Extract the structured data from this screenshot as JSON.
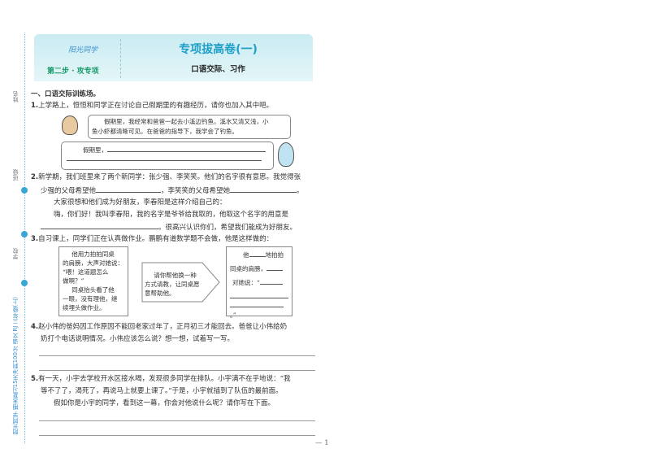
{
  "sidebar": {
    "name_label": "姓名",
    "class_label": "班级",
    "school_label": "学校",
    "series": "阳光同学 期末复习15天冲刺100分 语文 RJ 三年级(上)"
  },
  "header": {
    "logo": "阳光同学",
    "step": "第二步 · 攻专项",
    "title": "专项拔高卷(一)",
    "subtitle": "口语交际、习作"
  },
  "section1": "一、口语交际训练场。",
  "q1": {
    "num": "1.",
    "text": "上学路上，恒恒和同学正在讨论自己假期里的有趣经历，请你也加入其中吧。",
    "bubble1": "假期里，我经常和爸爸一起去小溪边钓鱼。溪水又清又浅，小",
    "bubble1b": "鱼小虾都清晰可见。在爸爸的指导下，我学会了钓鱼。",
    "bubble2": "假期里，"
  },
  "q2": {
    "num": "2.",
    "l1": "新学期，我们班里来了两个新同学：张少强、李笑笑。他们的名字很有意思。我觉得张",
    "l2a": "少强的父母希望他",
    "l2b": "，李笑笑的父母希望她",
    "l2c": "。",
    "l3": "大家很想和他们成为好朋友，李春阳是这样介绍自己的：",
    "l4": "嗨，你们好！我叫李春阳，我的名字是爷爷给我取的，他取这个名字的用意是",
    "l5": "。很高兴认识你们，希望我们能成为好朋友。"
  },
  "q3": {
    "num": "3.",
    "text": "自习课上，同学们正在认真做作业。鹏鹏有道数学题不会做，他是这样做的：",
    "left": [
      "他用力拍拍同桌",
      "的肩膀，大声对她说：",
      "“喂！这道题怎么",
      "做啊？”",
      "同桌抬头看了他",
      "一眼，没有理他，继",
      "续埋头做作业。"
    ],
    "arrow": [
      "请你帮他换一种",
      "方式请教，让同桌愿",
      "意帮助他。"
    ],
    "right": {
      "a": "他",
      "b": "地拍拍",
      "c": "同桌的肩膀，",
      "d": "对她说：“",
      "e": "。”"
    }
  },
  "q4": {
    "num": "4.",
    "l1": "赵小伟的爸妈因工作原因不能回老家过年了，正月初三才能回去。爸爸让小伟给奶",
    "l2": "奶打个电话说明情况。小伟应该怎么说？想一想，试着写一写。"
  },
  "q5": {
    "num": "5.",
    "l1": "有一天，小宇去学校开水区接水喝，发现很多同学在排队。小宇满不在乎地说：“我",
    "l2": "等不了了，渴死了，再说马上就要上课了。”于是，小宇就插到了队伍的最前面。",
    "l3": "假如你是小宇的同学，看到这一幕，你会对他说什么呢？请你写在下面。"
  },
  "page_number": "— 1"
}
